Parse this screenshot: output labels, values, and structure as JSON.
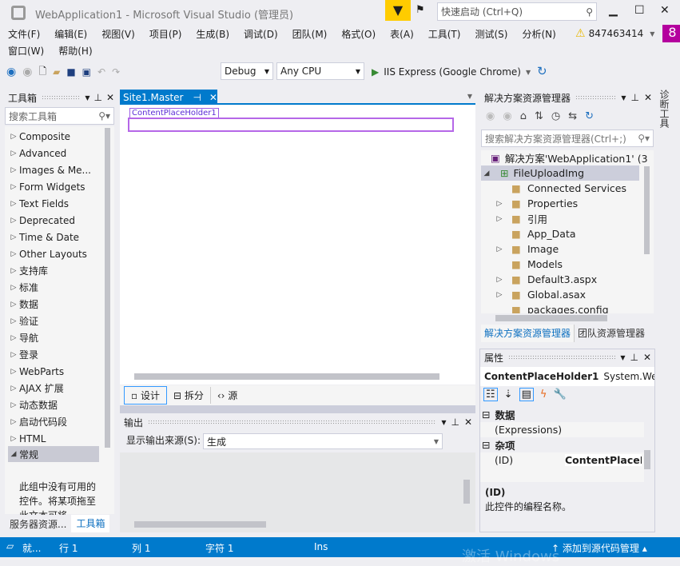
{
  "title": {
    "text": "WebApplication1 - Microsoft Visual Studio (管理员)",
    "quick_launch": "快速启动 (Ctrl+Q)"
  },
  "menu": [
    "文件(F)",
    "编辑(E)",
    "视图(V)",
    "项目(P)",
    "生成(B)",
    "调试(D)",
    "团队(M)",
    "格式(O)",
    "表(A)",
    "工具(T)",
    "测试(S)",
    "分析(N)"
  ],
  "menu2": [
    "窗口(W)",
    "帮助(H)"
  ],
  "account": {
    "name": "847463414",
    "badge": "8"
  },
  "toolbar": {
    "config": "Debug",
    "platform": "Any CPU",
    "run": "IIS Express (Google Chrome)"
  },
  "toolbox": {
    "title": "工具箱",
    "search_placeholder": "搜索工具箱",
    "items": [
      "Composite",
      "Advanced",
      "Images & Me...",
      "Form Widgets",
      "Text Fields",
      "Deprecated",
      "Time & Date",
      "Other Layouts",
      "支持库",
      "标准",
      "数据",
      "验证",
      "导航",
      "登录",
      "WebParts",
      "AJAX 扩展",
      "动态数据",
      "启动代码段",
      "HTML"
    ],
    "expanded": "常规",
    "empty_text": "此组中没有可用的控件。将某项拖至此文本可将",
    "tabs": [
      "服务器资源...",
      "工具箱"
    ]
  },
  "editor": {
    "tab": "Site1.Master",
    "placeholder": "ContentPlaceHolder1",
    "views": [
      "设计",
      "拆分",
      "源"
    ]
  },
  "output": {
    "title": "输出",
    "source_label": "显示输出来源(S):",
    "source": "生成"
  },
  "solution": {
    "title": "解决方案资源管理器",
    "search_placeholder": "搜索解决方案资源管理器(Ctrl+;)",
    "root": "解决方案'WebApplication1' (3",
    "project": "FileUploadImg",
    "items": [
      {
        "label": "Connected Services",
        "exp": false
      },
      {
        "label": "Properties",
        "exp": true
      },
      {
        "label": "引用",
        "exp": true
      },
      {
        "label": "App_Data",
        "exp": false
      },
      {
        "label": "Image",
        "exp": true
      },
      {
        "label": "Models",
        "exp": false
      },
      {
        "label": "Default3.aspx",
        "exp": true
      },
      {
        "label": "Global.asax",
        "exp": true
      },
      {
        "label": "packages.config",
        "exp": false
      }
    ],
    "tabs": [
      "解决方案资源管理器",
      "团队资源管理器"
    ]
  },
  "properties": {
    "title": "属性",
    "object": "ContentPlaceHolder1",
    "type": "System.We",
    "cat1": "数据",
    "prop1": "(Expressions)",
    "cat2": "杂项",
    "prop2": "(ID)",
    "value2": "ContentPlaceH",
    "desc_title": "(ID)",
    "desc": "此控件的编程名称。"
  },
  "side_tab": "诊断工具",
  "status": {
    "ready": "就...",
    "line": "行 1",
    "col": "列 1",
    "char": "字符 1",
    "ins": "Ins",
    "source_control": "添加到源代码管理"
  },
  "watermark": "激活 Windows"
}
